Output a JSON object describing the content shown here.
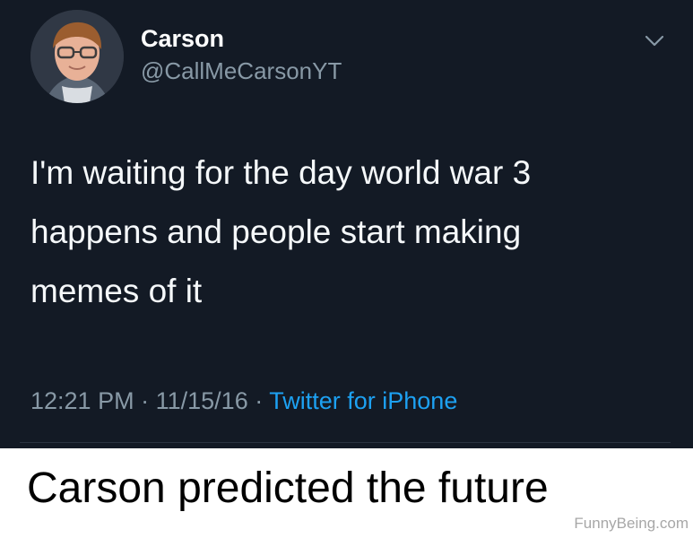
{
  "tweet": {
    "display_name": "Carson",
    "handle": "@CallMeCarsonYT",
    "text": "I'm waiting for the day world war 3\nhappens and people start making\nmemes of it",
    "time": "12:21 PM",
    "date": "11/15/16",
    "separator": "·",
    "source": "Twitter for iPhone",
    "menu_icon": "chevron-down-icon",
    "avatar_icon": "avatar-photo"
  },
  "caption": {
    "text": "Carson predicted the future"
  },
  "watermark": {
    "text": "FunnyBeing.com"
  },
  "colors": {
    "tweet_background": "#131a25",
    "primary_text": "#ffffff",
    "secondary_text": "#8899a6",
    "link_blue": "#1da1f2",
    "caption_background": "#ffffff",
    "caption_text": "#000000"
  }
}
